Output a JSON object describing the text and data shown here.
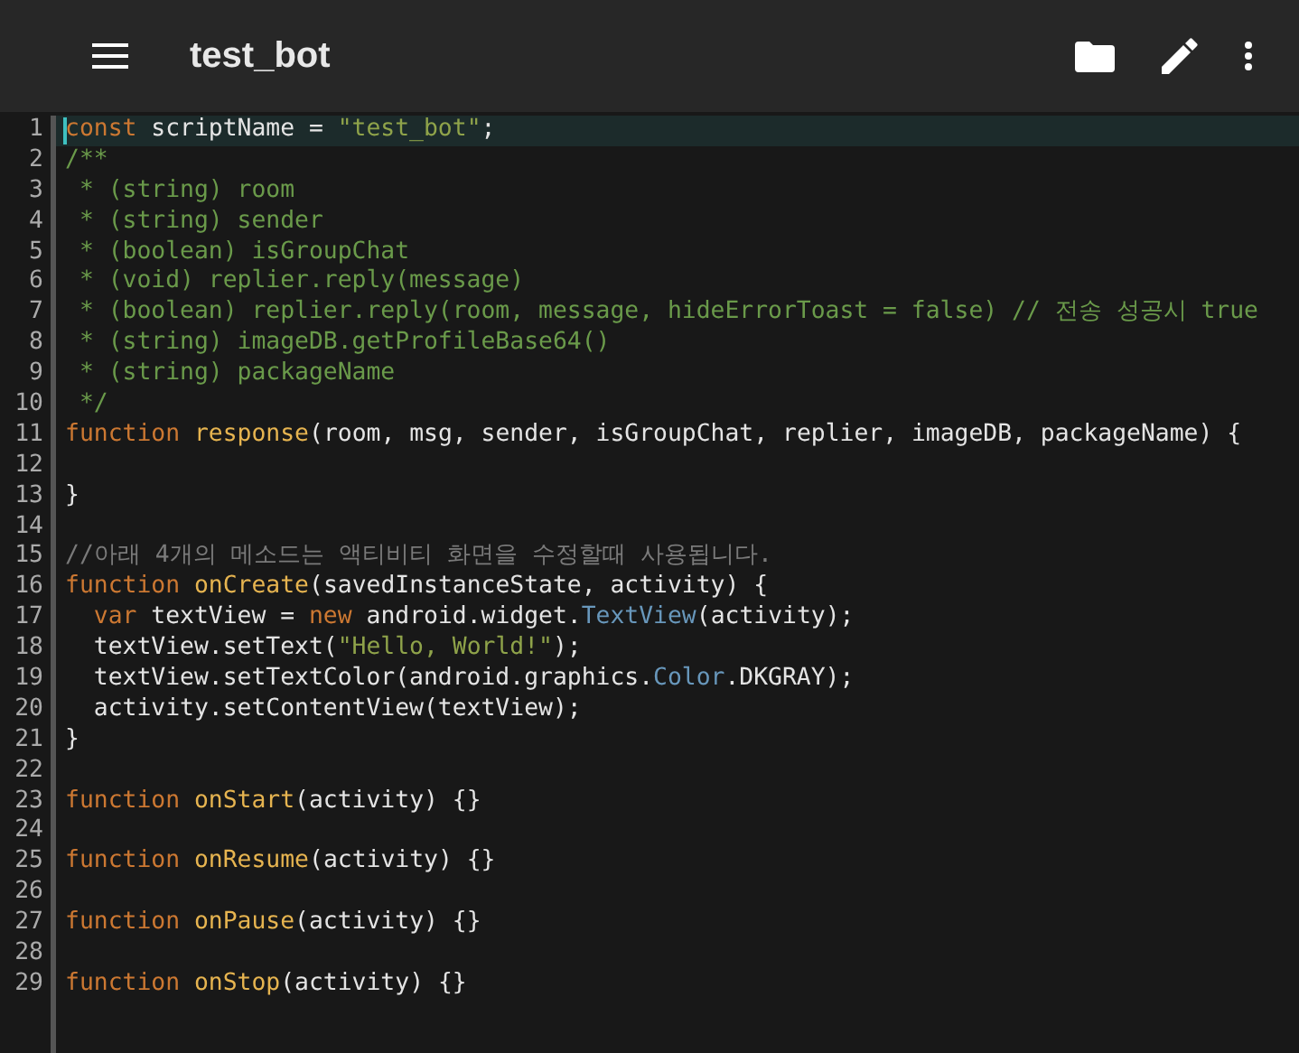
{
  "app_bar": {
    "title": "test_bot"
  },
  "editor": {
    "lines": [
      {
        "number": "1",
        "current": true,
        "tokens": [
          {
            "text": "const",
            "kind": "kw"
          },
          {
            "text": " scriptName = ",
            "kind": "plain"
          },
          {
            "text": "\"test_bot\"",
            "kind": "str"
          },
          {
            "text": ";",
            "kind": "plain"
          }
        ]
      },
      {
        "number": "2",
        "current": false,
        "tokens": [
          {
            "text": "/**",
            "kind": "doc"
          }
        ]
      },
      {
        "number": "3",
        "current": false,
        "tokens": [
          {
            "text": " * (string) room",
            "kind": "doc"
          }
        ]
      },
      {
        "number": "4",
        "current": false,
        "tokens": [
          {
            "text": " * (string) sender",
            "kind": "doc"
          }
        ]
      },
      {
        "number": "5",
        "current": false,
        "tokens": [
          {
            "text": " * (boolean) isGroupChat",
            "kind": "doc"
          }
        ]
      },
      {
        "number": "6",
        "current": false,
        "tokens": [
          {
            "text": " * (void) replier.reply(message)",
            "kind": "doc"
          }
        ]
      },
      {
        "number": "7",
        "current": false,
        "tokens": [
          {
            "text": " * (boolean) replier.reply(room, message, hideErrorToast = false) // 전송 성공시 true",
            "kind": "doc"
          }
        ]
      },
      {
        "number": "8",
        "current": false,
        "tokens": [
          {
            "text": " * (string) imageDB.getProfileBase64()",
            "kind": "doc"
          }
        ]
      },
      {
        "number": "9",
        "current": false,
        "tokens": [
          {
            "text": " * (string) packageName",
            "kind": "doc"
          }
        ]
      },
      {
        "number": "10",
        "current": false,
        "tokens": [
          {
            "text": " */",
            "kind": "doc"
          }
        ]
      },
      {
        "number": "11",
        "current": false,
        "tokens": [
          {
            "text": "function ",
            "kind": "kw"
          },
          {
            "text": "response",
            "kind": "fn"
          },
          {
            "text": "(room, msg, sender, isGroupChat, replier, imageDB, packageName) {",
            "kind": "plain"
          }
        ]
      },
      {
        "number": "12",
        "current": false
      },
      {
        "number": "13",
        "current": false,
        "tokens": [
          {
            "text": "}",
            "kind": "plain"
          }
        ]
      },
      {
        "number": "14",
        "current": false
      },
      {
        "number": "15",
        "current": false,
        "tokens": [
          {
            "text": "//아래 4개의 메소드는 액티비티 화면을 수정할때 사용됩니다.",
            "kind": "comment"
          }
        ]
      },
      {
        "number": "16",
        "current": false,
        "tokens": [
          {
            "text": "function ",
            "kind": "kw"
          },
          {
            "text": "onCreate",
            "kind": "fn"
          },
          {
            "text": "(savedInstanceState, activity) {",
            "kind": "plain"
          }
        ]
      },
      {
        "number": "17",
        "current": false,
        "tokens": [
          {
            "text": "  var",
            "kind": "kw"
          },
          {
            "text": " textView = ",
            "kind": "plain"
          },
          {
            "text": "new",
            "kind": "kw"
          },
          {
            "text": " android.widget.",
            "kind": "plain"
          },
          {
            "text": "TextView",
            "kind": "type"
          },
          {
            "text": "(activity);",
            "kind": "plain"
          }
        ]
      },
      {
        "number": "18",
        "current": false,
        "tokens": [
          {
            "text": "  textView.setText(",
            "kind": "plain"
          },
          {
            "text": "\"Hello, World!\"",
            "kind": "str"
          },
          {
            "text": ");",
            "kind": "plain"
          }
        ]
      },
      {
        "number": "19",
        "current": false,
        "tokens": [
          {
            "text": "  textView.setTextColor(android.graphics.",
            "kind": "plain"
          },
          {
            "text": "Color",
            "kind": "type"
          },
          {
            "text": ".DKGRAY);",
            "kind": "plain"
          }
        ]
      },
      {
        "number": "20",
        "current": false,
        "tokens": [
          {
            "text": "  activity.setContentView(textView);",
            "kind": "plain"
          }
        ]
      },
      {
        "number": "21",
        "current": false,
        "tokens": [
          {
            "text": "}",
            "kind": "plain"
          }
        ]
      },
      {
        "number": "22",
        "current": false
      },
      {
        "number": "23",
        "current": false,
        "tokens": [
          {
            "text": "function ",
            "kind": "kw"
          },
          {
            "text": "onStart",
            "kind": "fn"
          },
          {
            "text": "(activity) {}",
            "kind": "plain"
          }
        ]
      },
      {
        "number": "24",
        "current": false
      },
      {
        "number": "25",
        "current": false,
        "tokens": [
          {
            "text": "function ",
            "kind": "kw"
          },
          {
            "text": "onResume",
            "kind": "fn"
          },
          {
            "text": "(activity) {}",
            "kind": "plain"
          }
        ]
      },
      {
        "number": "26",
        "current": false
      },
      {
        "number": "27",
        "current": false,
        "tokens": [
          {
            "text": "function ",
            "kind": "kw"
          },
          {
            "text": "onPause",
            "kind": "fn"
          },
          {
            "text": "(activity) {}",
            "kind": "plain"
          }
        ]
      },
      {
        "number": "28",
        "current": false
      },
      {
        "number": "29",
        "current": false,
        "tokens": [
          {
            "text": "function ",
            "kind": "kw"
          },
          {
            "text": "onStop",
            "kind": "fn"
          },
          {
            "text": "(activity) {}",
            "kind": "plain"
          }
        ]
      }
    ]
  }
}
